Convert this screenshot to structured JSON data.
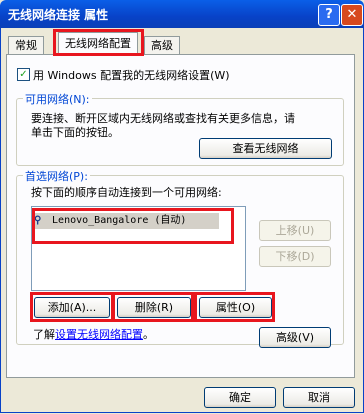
{
  "window": {
    "title": "无线网络连接 属性",
    "help": "?",
    "close": "✕"
  },
  "tabs": [
    {
      "label": "常规"
    },
    {
      "label": "无线网络配置"
    },
    {
      "label": "高级"
    }
  ],
  "use_windows": {
    "checked": true,
    "check_mark": "✓",
    "label": "用 Windows 配置我的无线网络设置(W)"
  },
  "available": {
    "label": "可用网络(N):",
    "description_line1": "要连接、断开区域内无线网络或查找有关更多信息，请",
    "description_line2": "单击下面的按钮。",
    "view_button": "查看无线网络"
  },
  "preferred": {
    "label": "首选网络(P):",
    "instruction": "按下面的顺序自动连接到一个可用网络:",
    "networks": [
      {
        "icon": "wireless-key-icon",
        "name": "Lenovo_Bangalore (自动)"
      }
    ],
    "move_up": "上移(U)",
    "move_down": "下移(D)",
    "add": "添加(A)...",
    "remove": "删除(R)",
    "properties": "属性(O)"
  },
  "learn": {
    "prefix": "了解",
    "link": "设置无线网络配置",
    "suffix": "。"
  },
  "advanced_button": "高级(V)",
  "footer": {
    "ok": "确定",
    "cancel": "取消"
  },
  "colors": {
    "highlight": "#E8161E",
    "titlebar": "#0842C7",
    "link": "#0000FF"
  }
}
